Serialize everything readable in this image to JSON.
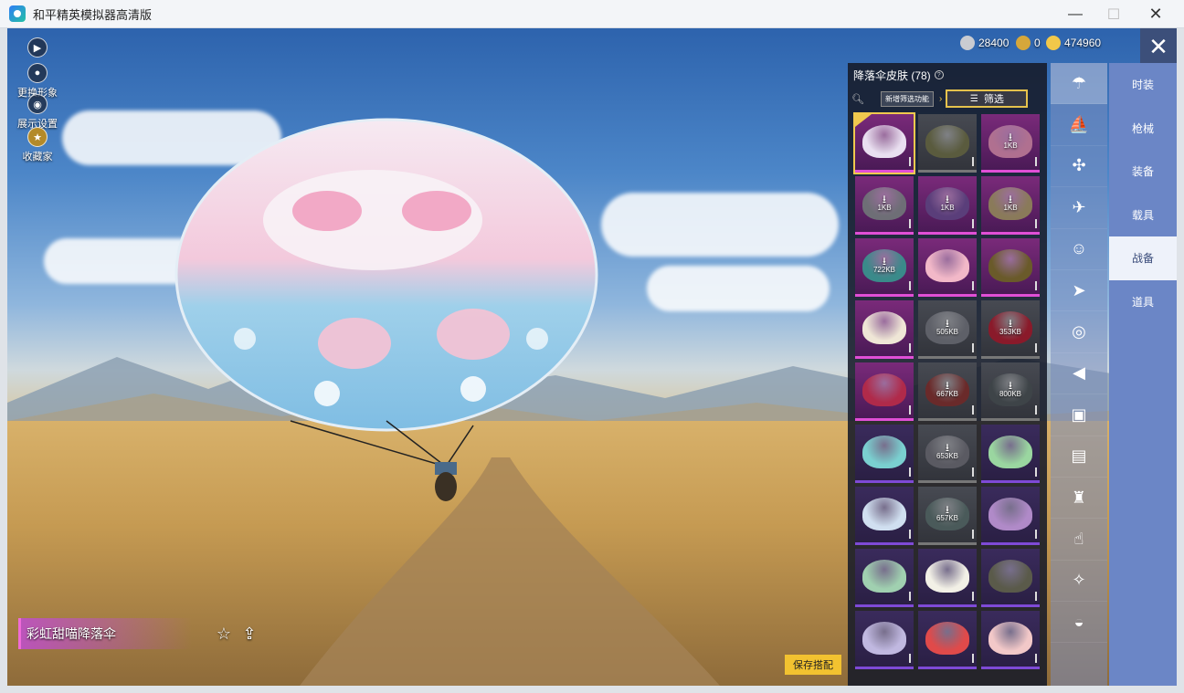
{
  "window": {
    "title": "和平精英模拟器高清版",
    "min": "—",
    "max": "☐",
    "close": "✕"
  },
  "left_buttons": [
    {
      "label": "",
      "icon": "play-icon"
    },
    {
      "label": "更换形象",
      "icon": "avatar-icon"
    },
    {
      "label": "展示设置",
      "icon": "eye-icon"
    },
    {
      "label": "收藏家",
      "icon": "collector-badge-icon"
    }
  ],
  "currency": [
    {
      "value": "28400",
      "icon": "silver-coin-icon",
      "color": "#c9cbd1"
    },
    {
      "value": "0",
      "icon": "badge-coin-icon",
      "color": "#d6a73b"
    },
    {
      "value": "474960",
      "icon": "gold-coin-icon",
      "color": "#f2c84a"
    }
  ],
  "panel": {
    "title": "降落伞皮肤 (78)",
    "help": "?",
    "new_filter": "新增筛选功能",
    "filter": "筛选"
  },
  "skins": [
    {
      "style": "pink sel",
      "color": "#e9dff0",
      "download": ""
    },
    {
      "style": "grey",
      "color": "#5a5b3e",
      "download": ""
    },
    {
      "style": "pink",
      "color": "#b07090",
      "download": "1KB"
    },
    {
      "style": "pink",
      "color": "#6e6e76",
      "download": "1KB"
    },
    {
      "style": "pink",
      "color": "#5a3e7a",
      "download": "1KB"
    },
    {
      "style": "pink",
      "color": "#8a7a5a",
      "download": "1KB"
    },
    {
      "style": "pink",
      "color": "#3a8a8a",
      "download": "722KB"
    },
    {
      "style": "pink",
      "color": "#f2b8c8",
      "download": ""
    },
    {
      "style": "pink",
      "color": "#6a5a2a",
      "download": ""
    },
    {
      "style": "pink",
      "color": "#efe6d6",
      "download": ""
    },
    {
      "style": "grey",
      "color": "#5e6068",
      "download": "505KB"
    },
    {
      "style": "grey",
      "color": "#8a1a2a",
      "download": "353KB"
    },
    {
      "style": "pink",
      "color": "#b02a4a",
      "download": ""
    },
    {
      "style": "grey",
      "color": "#6a2a2a",
      "download": "667KB"
    },
    {
      "style": "grey",
      "color": "#3e4448",
      "download": "800KB"
    },
    {
      "style": "",
      "color": "#7ad0d0",
      "download": ""
    },
    {
      "style": "grey",
      "color": "#5a5a62",
      "download": "653KB"
    },
    {
      "style": "",
      "color": "#9ad6a0",
      "download": ""
    },
    {
      "style": "",
      "color": "#d0dff0",
      "download": ""
    },
    {
      "style": "grey",
      "color": "#4a5a5a",
      "download": "657KB"
    },
    {
      "style": "",
      "color": "#b08ac8",
      "download": ""
    },
    {
      "style": "",
      "color": "#a0d0b0",
      "download": ""
    },
    {
      "style": "",
      "color": "#f2f0e6",
      "download": ""
    },
    {
      "style": "",
      "color": "#5a5a4a",
      "download": ""
    },
    {
      "style": "",
      "color": "#c0b8e0",
      "download": ""
    },
    {
      "style": "",
      "color": "#e04a4a",
      "download": ""
    },
    {
      "style": "",
      "color": "#f2c8c8",
      "download": ""
    }
  ],
  "categories": [
    {
      "icon": "parachute-icon",
      "active": true
    },
    {
      "icon": "boat-icon"
    },
    {
      "icon": "drone-icon"
    },
    {
      "icon": "plane-icon"
    },
    {
      "icon": "emote-icon"
    },
    {
      "icon": "jet-icon"
    },
    {
      "icon": "robot-icon"
    },
    {
      "icon": "speaker-icon"
    },
    {
      "icon": "sticker-icon"
    },
    {
      "icon": "image-icon"
    },
    {
      "icon": "extinguisher-icon"
    },
    {
      "icon": "finger-tap-icon"
    },
    {
      "icon": "sparkle-wand-icon"
    },
    {
      "icon": "cloche-icon"
    }
  ],
  "tabs": [
    {
      "label": "时装"
    },
    {
      "label": "枪械"
    },
    {
      "label": "装备"
    },
    {
      "label": "载具"
    },
    {
      "label": "战备",
      "active": true
    },
    {
      "label": "道具"
    }
  ],
  "bottom": {
    "skin_name": "彩虹甜喵降落伞",
    "save": "保存搭配"
  }
}
